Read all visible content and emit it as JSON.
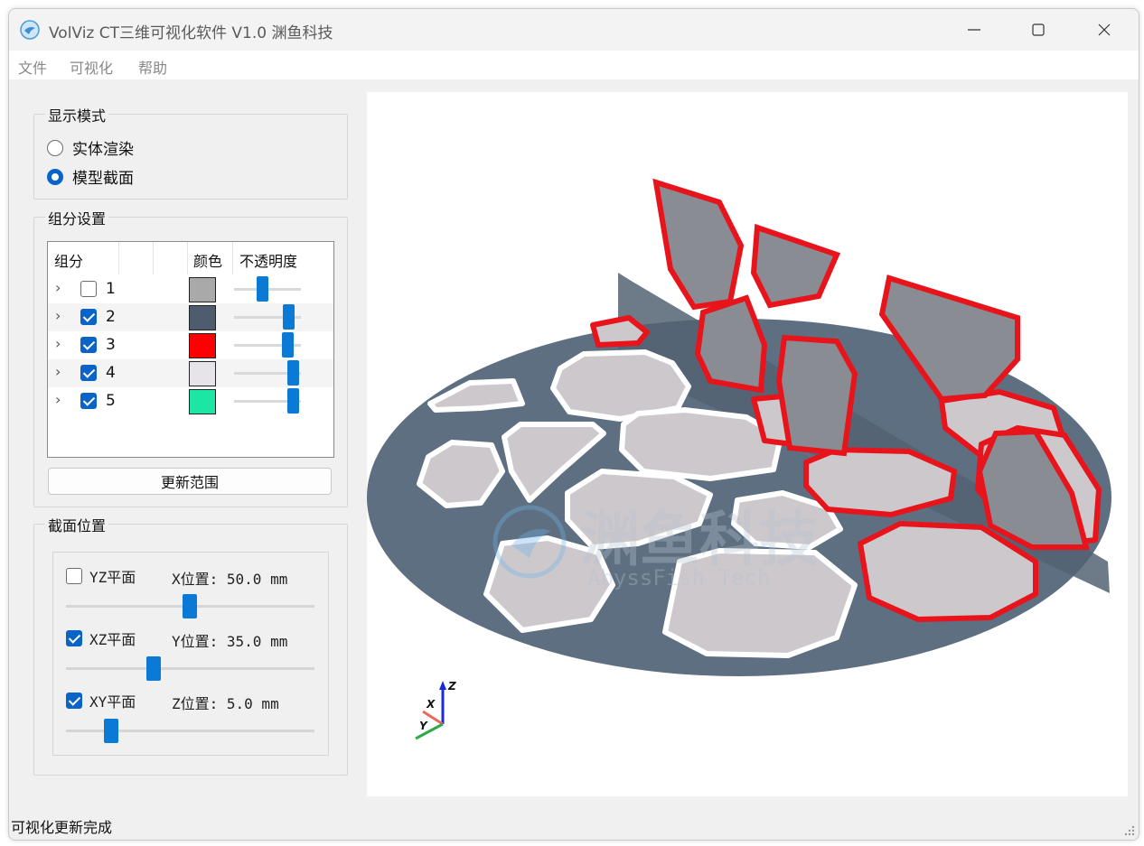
{
  "window": {
    "title": "VolViz CT三维可视化软件 V1.0 渊鱼科技",
    "icon": "app-logo-icon",
    "controls": [
      "minimize-icon",
      "maximize-icon",
      "close-icon"
    ]
  },
  "menu": {
    "items": [
      {
        "label": "文件"
      },
      {
        "label": "可视化"
      },
      {
        "label": "帮助"
      }
    ]
  },
  "display_mode": {
    "title": "显示模式",
    "options": [
      {
        "label": "实体渲染",
        "selected": false
      },
      {
        "label": "模型截面",
        "selected": true
      }
    ]
  },
  "components": {
    "title": "组分设置",
    "headers": {
      "component": "组分",
      "color": "颜色",
      "opacity": "不透明度"
    },
    "rows": [
      {
        "label": "1",
        "checked": false,
        "color": "#a9a9a9",
        "opacity": 0.4
      },
      {
        "label": "2",
        "checked": true,
        "color": "#4d5d6d",
        "opacity": 0.8
      },
      {
        "label": "3",
        "checked": true,
        "color": "#ff0000",
        "opacity": 0.8
      },
      {
        "label": "4",
        "checked": true,
        "color": "#e6e4ea",
        "opacity": 0.9
      },
      {
        "label": "5",
        "checked": true,
        "color": "#1de6a4",
        "opacity": 0.9
      }
    ],
    "update_button": "更新范围"
  },
  "section": {
    "title": "截面位置",
    "planes": [
      {
        "label": "YZ平面",
        "checked": false,
        "position_label": "X位置: 50.0 mm",
        "slider": 0.5
      },
      {
        "label": "XZ平面",
        "checked": true,
        "position_label": "Y位置: 35.0 mm",
        "slider": 0.35
      },
      {
        "label": "XY平面",
        "checked": true,
        "position_label": "Z位置: 5.0 mm",
        "slider": 0.18
      }
    ]
  },
  "viewport": {
    "watermark": {
      "title": "渊鱼科技",
      "subtitle": "AbyssFish Tech"
    },
    "axes": {
      "x": "X",
      "y": "Y",
      "z": "Z"
    },
    "colors": {
      "matrix": "#5d6f80",
      "particle": "#cdc8cc",
      "boundary": "#e8141c"
    }
  },
  "status": {
    "text": "可视化更新完成"
  }
}
